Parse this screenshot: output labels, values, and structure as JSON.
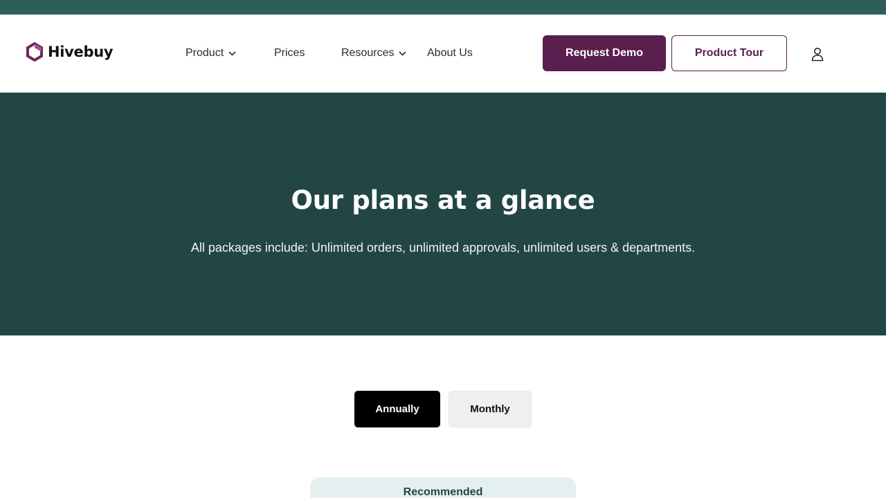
{
  "brand": {
    "name": "Hivebuy",
    "accent": "#5a1f4e",
    "dark_green": "#224644",
    "top_bar": "#2d5e58"
  },
  "nav": {
    "product": "Product",
    "prices": "Prices",
    "resources": "Resources",
    "about": "About Us"
  },
  "actions": {
    "request_demo": "Request Demo",
    "product_tour": "Product Tour",
    "user_icon": "user-icon"
  },
  "hero": {
    "title": "Our plans at a glance",
    "subtitle": "All packages include: Unlimited orders, unlimited approvals, unlimited users & departments."
  },
  "billing_toggle": {
    "options": [
      "Annually",
      "Monthly"
    ],
    "selected": "Annually"
  },
  "plan_badge": "Recommended"
}
